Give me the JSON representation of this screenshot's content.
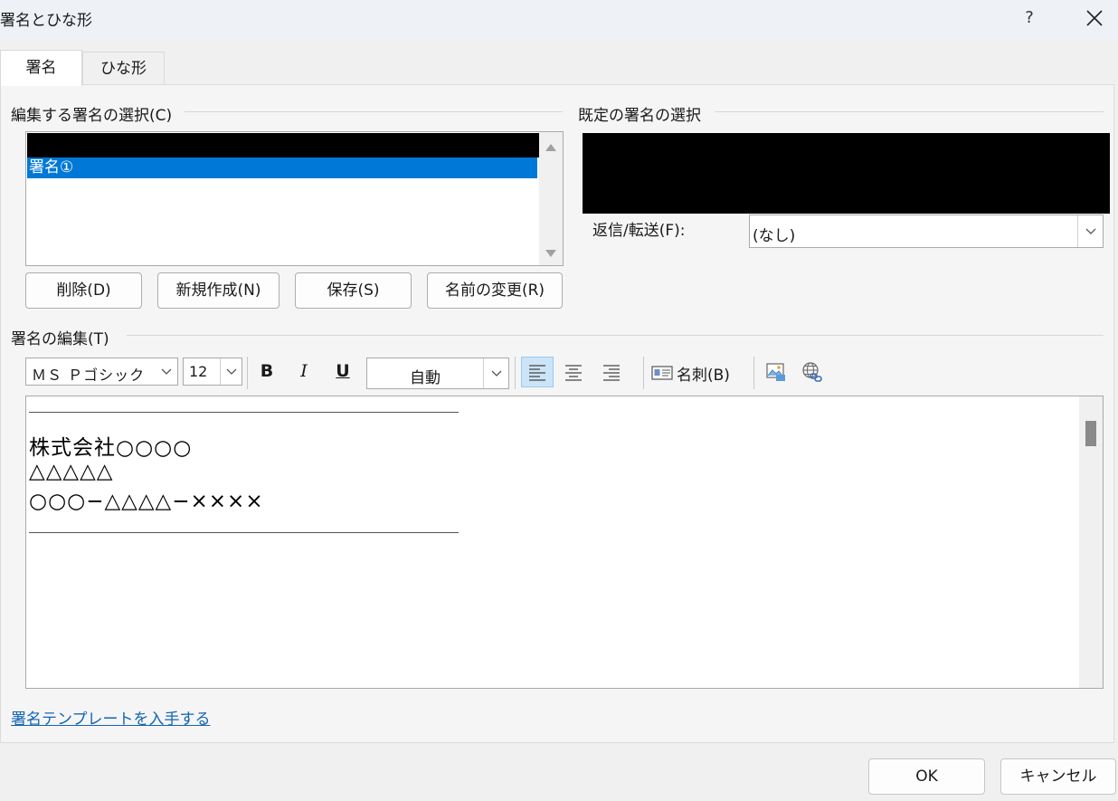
{
  "window": {
    "title": "署名とひな形",
    "help_label": "?"
  },
  "tabs": [
    {
      "label": "署名",
      "active": true
    },
    {
      "label": "ひな形",
      "active": false
    }
  ],
  "edit_signature_select": {
    "label": "編集する署名の選択(C)",
    "items": [
      {
        "label": "",
        "redacted": true
      },
      {
        "label": "署名①",
        "selected": true
      }
    ]
  },
  "buttons": {
    "delete": "削除(D)",
    "new": "新規作成(N)",
    "save": "保存(S)",
    "rename": "名前の変更(R)"
  },
  "default_signature": {
    "label": "既定の署名の選択",
    "reply_forward_label": "返信/転送(F):",
    "reply_forward_value": "(なし)"
  },
  "edit_signature": {
    "label": "署名の編集(T)"
  },
  "toolbar": {
    "font": "ＭＳ Ｐゴシック",
    "size": "12",
    "bold": "B",
    "italic": "I",
    "underline": "U",
    "color": "自動",
    "business_card": "名刺(B)"
  },
  "signature_body": {
    "lines": [
      "株式会社○○○○",
      "△△△△△",
      "○○○−△△△△−××××"
    ]
  },
  "template_link": "署名テンプレートを入手する",
  "footer": {
    "ok": "OK",
    "cancel": "キャンセル"
  },
  "colors": {
    "selection": "#0078d7",
    "link": "#1464b4"
  }
}
